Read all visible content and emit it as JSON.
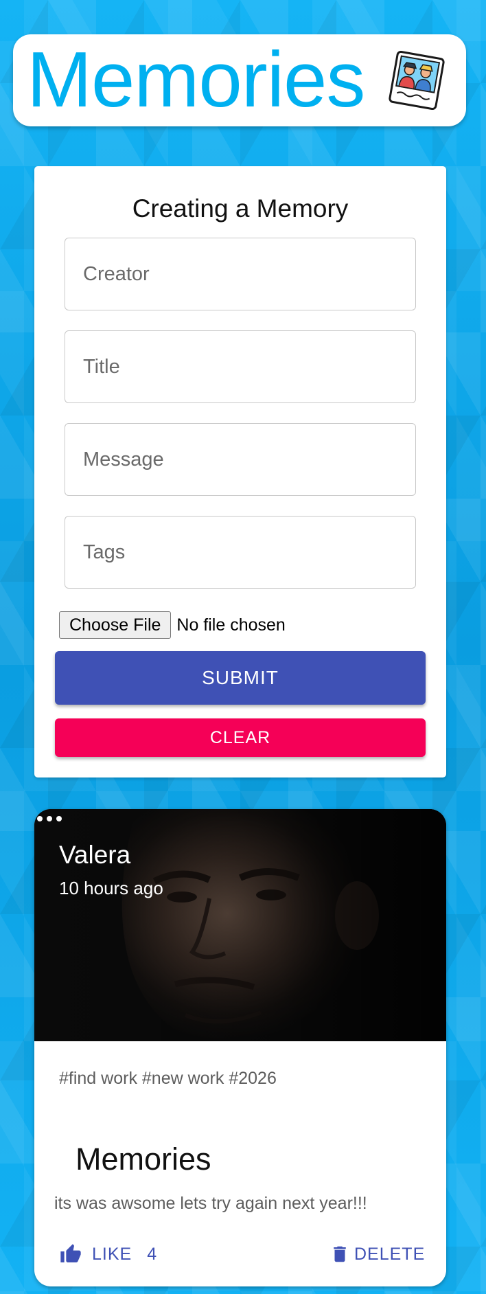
{
  "header": {
    "title": "Memories",
    "logo_icon": "memories-photo-icon"
  },
  "form": {
    "heading": "Creating a Memory",
    "fields": {
      "creator": {
        "placeholder": "Creator",
        "value": ""
      },
      "title": {
        "placeholder": "Title",
        "value": ""
      },
      "message": {
        "placeholder": "Message",
        "value": ""
      },
      "tags": {
        "placeholder": "Tags",
        "value": ""
      }
    },
    "file_button_label": "Choose File",
    "file_status": "No file chosen",
    "submit_label": "SUBMIT",
    "clear_label": "CLEAR"
  },
  "post": {
    "creator": "Valera",
    "time": "10 hours ago",
    "tags": "#find work #new work #2026",
    "title": "Memories",
    "message": "its was awsome lets try again next year!!!",
    "like_label": "LIKE",
    "like_count": "4",
    "delete_label": "DELETE"
  },
  "colors": {
    "brand": "#00b0f0",
    "primary": "#3f51b5",
    "secondary": "#f50057",
    "background": "#0aa3e6"
  }
}
